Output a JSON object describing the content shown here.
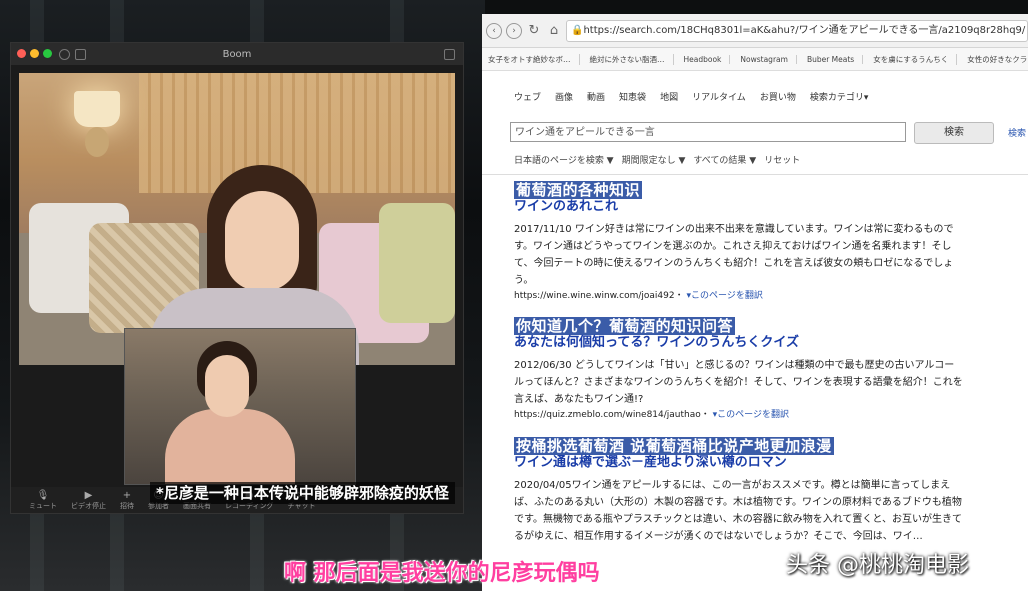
{
  "zoom": {
    "title": "Boom",
    "toolbar": [
      {
        "icon": "mic-icon",
        "label": "ミュート"
      },
      {
        "icon": "video-icon",
        "label": "ビデオ停止"
      },
      {
        "icon": "invite-icon",
        "label": "招待"
      },
      {
        "icon": "participants-icon",
        "label": "参加者"
      },
      {
        "icon": "share-icon",
        "label": "画面共有"
      },
      {
        "icon": "record-icon",
        "label": "レコーディング"
      },
      {
        "icon": "chat-icon",
        "label": "チャット"
      }
    ],
    "subtitle": "*尼彦是一种日本传说中能够辟邪除疫的妖怪"
  },
  "browser": {
    "url": "https://search.com/18CHq8301l=aK&ahu?/ワイン通をアピールできる一言/a2109q8r28hq9/",
    "bookmarks": [
      "女子をオトす絶妙なボ…",
      "絶対に外さない脂酒…",
      "Headbook",
      "Nowstagram",
      "Buber Meats",
      "女を虜にするうんちく",
      "女性の好きなクラシック",
      "グ"
    ],
    "nav": [
      "ウェブ",
      "画像",
      "動画",
      "知恵袋",
      "地図",
      "リアルタイム",
      "お買い物",
      "検索カテゴリ▾"
    ],
    "search_value": "ワイン通をアピールできる一言",
    "search_button": "検索",
    "search_extra": "検索",
    "filters": [
      "日本語のページを検索 ▼",
      "期間限定なし ▼",
      "すべての結果 ▼",
      "リセット"
    ],
    "results": [
      {
        "overlay": "葡萄酒的各种知识",
        "title": "ワインのあれこれ",
        "snippet": "2017/11/10 ワイン好きは常にワインの出来不出来を意識しています。ワインは常に変わるものです。ワイン通はどうやってワインを選ぶのか。これさえ抑えておけばワイン通を名乗れます！そして、今回テートの時に使えるワインのうんちくも紹介！これを言えば彼女の頬もロゼになるでしょう。",
        "url": "https://wine.wine.winw.com/joai492・",
        "cache": "▾このページを翻訳"
      },
      {
        "overlay": "你知道几个？葡萄酒的知识问答",
        "title": "あなたは何個知ってる？ワインのうんちくクイズ",
        "snippet": "2012/06/30 どうしてワインは「甘い」と感じるの？ワインは種類の中で最も歴史の古いアルコールってほんと？さまざまなワインのうんちくを紹介！そして、ワインを表現する語彙を紹介！これを言えば、あなたもワイン通!?",
        "url": "https://quiz.zmeblo.com/wine814/jauthao・",
        "cache": "▾このページを翻訳"
      },
      {
        "overlay": "按桶挑选葡萄酒 说葡萄酒桶比说产地更加浪漫",
        "title": "ワイン通は樽で選ぶ－産地より深い樽のロマン",
        "snippet": "2020/04/05ワイン通をアピールするには、この一言がおススメです。樽とは簡単に言ってしまえば、ふたのある丸い（大形の）木製の容器です。木は植物です。ワインの原材料であるブドウも植物です。無機物である瓶やプラスチックとは違い、木の容器に飲み物を入れて置くと、お互いが生きてるがゆえに、相互作用するイメージが湧くのではないでしょうか？そこで、今回は、ワイ…",
        "url": "",
        "cache": ""
      }
    ]
  },
  "overlay": {
    "bottom_subtitle": "啊 那后面是我送你的尼彦玩偶吗",
    "watermark": "头条 @桃桃淘电影"
  }
}
